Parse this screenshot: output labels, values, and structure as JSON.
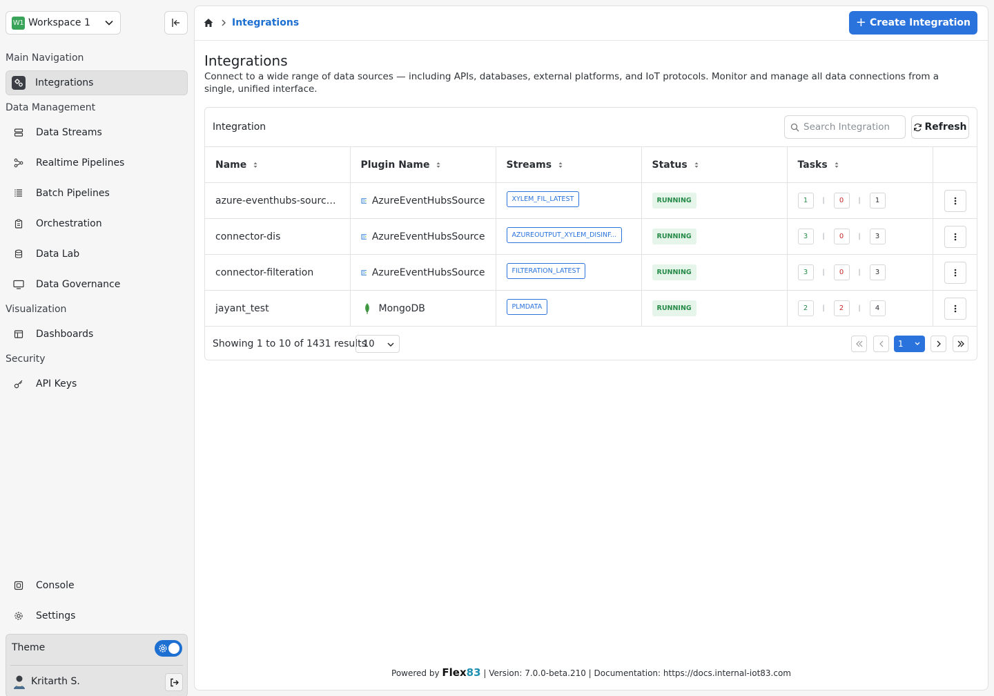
{
  "workspace": {
    "badge": "W1",
    "name": "Workspace 1"
  },
  "nav": {
    "sections": {
      "main": "Main Navigation",
      "data_management": "Data Management",
      "visualization": "Visualization",
      "security": "Security"
    },
    "items": {
      "integrations": "Integrations",
      "data_streams": "Data Streams",
      "realtime_pipelines": "Realtime Pipelines",
      "batch_pipelines": "Batch Pipelines",
      "orchestration": "Orchestration",
      "data_lab": "Data Lab",
      "data_governance": "Data Governance",
      "dashboards": "Dashboards",
      "api_keys": "API Keys",
      "console": "Console",
      "settings": "Settings"
    }
  },
  "theme": {
    "label": "Theme",
    "dark_enabled": true
  },
  "user": {
    "name": "Kritarth S."
  },
  "breadcrumb": {
    "current": "Integrations"
  },
  "header": {
    "create_label": "Create Integration"
  },
  "page": {
    "title": "Integrations",
    "description": "Connect to a wide range of data sources — including APIs, databases, external platforms, and IoT protocols. Monitor and manage all data connections from a single, unified interface."
  },
  "card": {
    "title": "Integration",
    "search_placeholder": "Search Integration",
    "refresh_label": "Refresh"
  },
  "table": {
    "columns": [
      "Name",
      "Plugin Name",
      "Streams",
      "Status",
      "Tasks"
    ],
    "rows": [
      {
        "name": "azure-eventhubs-source-...",
        "plugin": "AzureEventHubsSource",
        "plugin_icon": "azure-eventhubs-icon",
        "stream": "XYLEM_FIL_LATEST",
        "status": "RUNNING",
        "tasks": [
          "1",
          "0",
          "1"
        ]
      },
      {
        "name": "connector-dis",
        "plugin": "AzureEventHubsSource",
        "plugin_icon": "azure-eventhubs-icon",
        "stream": "AZUREOUTPUT_XYLEM_DISINF...",
        "status": "RUNNING",
        "tasks": [
          "3",
          "0",
          "3"
        ]
      },
      {
        "name": "connector-filteration",
        "plugin": "AzureEventHubsSource",
        "plugin_icon": "azure-eventhubs-icon",
        "stream": "FILTERATION_LATEST",
        "status": "RUNNING",
        "tasks": [
          "3",
          "0",
          "3"
        ]
      },
      {
        "name": "jayant_test",
        "plugin": "MongoDB",
        "plugin_icon": "mongodb-leaf-icon",
        "stream": "PLMDATA",
        "status": "RUNNING",
        "tasks": [
          "2",
          "2",
          "4"
        ]
      }
    ]
  },
  "pagination": {
    "summary": "Showing 1 to 10 of 1431 results",
    "page_size": "10",
    "current_page": "1"
  },
  "footer": {
    "powered_by": "Powered by",
    "brand_text": "Flex",
    "brand_num": "83",
    "version": "| Version: 7.0.0-beta.210 | Documentation: https://docs.internal-iot83.com"
  },
  "colors": {
    "accent": "#2a73dd",
    "running_bg": "#e5f5ea",
    "running_text": "#258a47",
    "task_red": "#c62828"
  }
}
